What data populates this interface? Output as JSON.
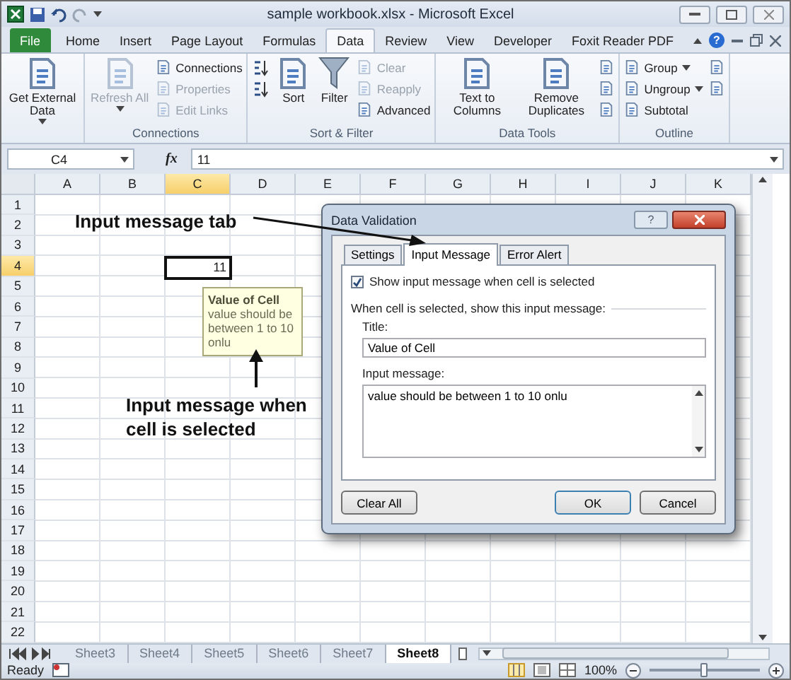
{
  "title_bar": {
    "title": "sample workbook.xlsx - Microsoft Excel"
  },
  "ribbon": {
    "tabs": [
      {
        "label": "File",
        "kind": "file",
        "selected": false
      },
      {
        "label": "Home",
        "kind": "tab",
        "selected": false
      },
      {
        "label": "Insert",
        "kind": "tab",
        "selected": false
      },
      {
        "label": "Page Layout",
        "kind": "tab",
        "selected": false
      },
      {
        "label": "Formulas",
        "kind": "tab",
        "selected": false
      },
      {
        "label": "Data",
        "kind": "tab",
        "selected": true
      },
      {
        "label": "Review",
        "kind": "tab",
        "selected": false
      },
      {
        "label": "View",
        "kind": "tab",
        "selected": false
      },
      {
        "label": "Developer",
        "kind": "tab",
        "selected": false
      },
      {
        "label": "Foxit Reader PDF",
        "kind": "tab",
        "selected": false
      }
    ],
    "help_label": "?",
    "groups": [
      {
        "items": [
          {
            "kind": "large",
            "label": "Get External Data",
            "dropdown": true,
            "disabled": false
          }
        ]
      },
      {
        "label": "Connections",
        "items": [
          {
            "kind": "large",
            "label": "Refresh All",
            "dropdown": true,
            "disabled": true
          },
          {
            "kind": "small",
            "label": "Connections",
            "disabled": false
          },
          {
            "kind": "small",
            "label": "Properties",
            "disabled": true
          },
          {
            "kind": "small",
            "label": "Edit Links",
            "disabled": true
          }
        ]
      },
      {
        "label": "Sort & Filter",
        "items": [
          {
            "kind": "sort",
            "disabled": false
          },
          {
            "kind": "sort",
            "disabled": false
          },
          {
            "kind": "large",
            "label": "Sort",
            "disabled": false
          },
          {
            "kind": "filter",
            "label": "Filter",
            "disabled": false
          },
          {
            "kind": "small",
            "label": "Clear",
            "disabled": true
          },
          {
            "kind": "small",
            "label": "Reapply",
            "disabled": true
          },
          {
            "kind": "small",
            "label": "Advanced",
            "disabled": false
          }
        ]
      },
      {
        "label": "Data Tools",
        "items": [
          {
            "kind": "large",
            "label": "Text to Columns",
            "disabled": false
          },
          {
            "kind": "large",
            "label": "Remove Duplicates",
            "disabled": false
          },
          {
            "kind": "icon",
            "disabled": false
          },
          {
            "kind": "icon",
            "disabled": false
          },
          {
            "kind": "icon",
            "disabled": false
          }
        ]
      },
      {
        "label": "Outline",
        "items": [
          {
            "kind": "small",
            "label": "Group",
            "dropdown": true,
            "disabled": false
          },
          {
            "kind": "small",
            "label": "Ungroup",
            "dropdown": true,
            "disabled": false
          },
          {
            "kind": "small",
            "label": "Subtotal",
            "disabled": false
          },
          {
            "kind": "icon",
            "disabled": false
          },
          {
            "kind": "icon",
            "disabled": false
          }
        ]
      }
    ]
  },
  "formula_bar": {
    "name_box": "C4",
    "function_label": "fx",
    "formula": "11"
  },
  "sheet": {
    "columns": [
      {
        "label": "A",
        "selected": false
      },
      {
        "label": "B",
        "selected": false
      },
      {
        "label": "C",
        "selected": true
      },
      {
        "label": "D",
        "selected": false
      },
      {
        "label": "E",
        "selected": false
      },
      {
        "label": "F",
        "selected": false
      },
      {
        "label": "G",
        "selected": false
      },
      {
        "label": "H",
        "selected": false
      },
      {
        "label": "I",
        "selected": false
      },
      {
        "label": "J",
        "selected": false
      },
      {
        "label": "K",
        "selected": false
      }
    ],
    "rows": [
      {
        "label": "1",
        "selected": false
      },
      {
        "label": "2",
        "selected": false
      },
      {
        "label": "3",
        "selected": false
      },
      {
        "label": "4",
        "selected": true
      },
      {
        "label": "5",
        "selected": false
      },
      {
        "label": "6",
        "selected": false
      },
      {
        "label": "7",
        "selected": false
      },
      {
        "label": "8",
        "selected": false
      },
      {
        "label": "9",
        "selected": false
      },
      {
        "label": "10",
        "selected": false
      },
      {
        "label": "11",
        "selected": false
      },
      {
        "label": "12",
        "selected": false
      },
      {
        "label": "13",
        "selected": false
      },
      {
        "label": "14",
        "selected": false
      },
      {
        "label": "15",
        "selected": false
      },
      {
        "label": "16",
        "selected": false
      },
      {
        "label": "17",
        "selected": false
      },
      {
        "label": "18",
        "selected": false
      },
      {
        "label": "19",
        "selected": false
      },
      {
        "label": "20",
        "selected": false
      },
      {
        "label": "21",
        "selected": false
      },
      {
        "label": "22",
        "selected": false
      }
    ],
    "active_cell": {
      "value": "11"
    },
    "input_tooltip": {
      "title": "Value of Cell",
      "message": "value should be between 1 to 10 onlu"
    }
  },
  "annotations": [
    {
      "text": "Input message tab"
    },
    {
      "text": "Input message when cell is selected"
    }
  ],
  "dialog": {
    "title": "Data Validation",
    "help_label": "?",
    "tabs": [
      {
        "label": "Settings",
        "selected": false
      },
      {
        "label": "Input Message",
        "selected": true
      },
      {
        "label": "Error Alert",
        "selected": false
      }
    ],
    "show_message": {
      "label": "Show input message when cell is selected",
      "checked": true
    },
    "section_label": "When cell is selected, show this input message:",
    "title_label": "Title:",
    "title_value": "Value of Cell",
    "message_label": "Input message:",
    "message_value": "value should be between 1 to 10 onlu",
    "buttons": [
      {
        "label": "Clear All",
        "kind": "left",
        "default": false
      },
      {
        "label": "OK",
        "kind": "right",
        "default": true
      },
      {
        "label": "Cancel",
        "kind": "right",
        "default": false
      }
    ]
  },
  "sheet_tabs": [
    {
      "label": "Sheet3",
      "selected": false
    },
    {
      "label": "Sheet4",
      "selected": false
    },
    {
      "label": "Sheet5",
      "selected": false
    },
    {
      "label": "Sheet6",
      "selected": false
    },
    {
      "label": "Sheet7",
      "selected": false
    },
    {
      "label": "Sheet8",
      "selected": true
    }
  ],
  "status_bar": {
    "status": "Ready",
    "zoom": "100%",
    "zoom_slider": {
      "level": 0.5
    }
  }
}
